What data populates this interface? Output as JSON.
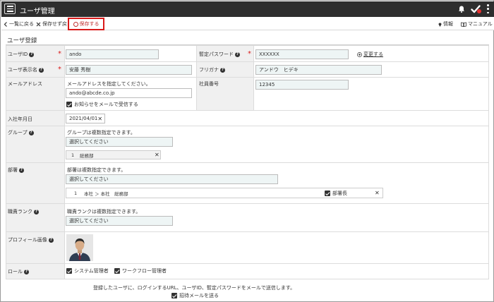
{
  "app": {
    "title": "ユーザ管理"
  },
  "toolbar": {
    "back_label": "一覧に戻る",
    "discard_label": "保存せず戻る",
    "save_label": "保存する",
    "info_label": "情報",
    "manual_label": "マニュアル"
  },
  "section": {
    "title": "ユーザ登録"
  },
  "form": {
    "user_id": {
      "label": "ユーザID",
      "value": "ando"
    },
    "temp_password": {
      "label": "暫定パスワード",
      "value": "XXXXXX",
      "change_label": "変更する"
    },
    "display_name": {
      "label": "ユーザ表示名",
      "value": "安藤 秀樹"
    },
    "furigana": {
      "label": "フリガナ",
      "value": "アンドウ　ヒデキ"
    },
    "email": {
      "label": "メールアドレス",
      "hint": "メールアドレスを指定してください。",
      "value": "ando@abcde.co.jp",
      "notify_label": "お知らせをメールで受信する"
    },
    "employee_no": {
      "label": "社員番号",
      "value": "12345"
    },
    "join_date": {
      "label": "入社年月日",
      "value": "2021/04/01"
    },
    "group": {
      "label": "グループ",
      "hint": "グループは複数指定できます。",
      "placeholder": "選択してください",
      "items": [
        {
          "index": "1",
          "name": "総務部"
        }
      ]
    },
    "department": {
      "label": "部署",
      "hint": "部署は複数指定できます。",
      "placeholder": "選択してください",
      "items": [
        {
          "index": "1",
          "name": "本社 ＞ 本社　総務部",
          "head_label": "部署長"
        }
      ]
    },
    "job_rank": {
      "label": "職責ランク",
      "hint": "職責ランクは複数指定できます。",
      "placeholder": "選択してください"
    },
    "profile_image": {
      "label": "プロフィール画像"
    },
    "role": {
      "label": "ロール",
      "options": [
        "システム管理者",
        "ワークフロー管理者"
      ]
    }
  },
  "footer": {
    "note": "登録したユーザに、ログインするURL、ユーザID、暫定パスワードをメールで送信します。",
    "invite_label": "招待メールを送る"
  },
  "colors": {
    "titlebar": "#2e2e2e",
    "highlight": "#d91a1a",
    "required": "#d91a1a",
    "input_bg": "#eef5f5",
    "label_bg": "#f0f0f0"
  }
}
